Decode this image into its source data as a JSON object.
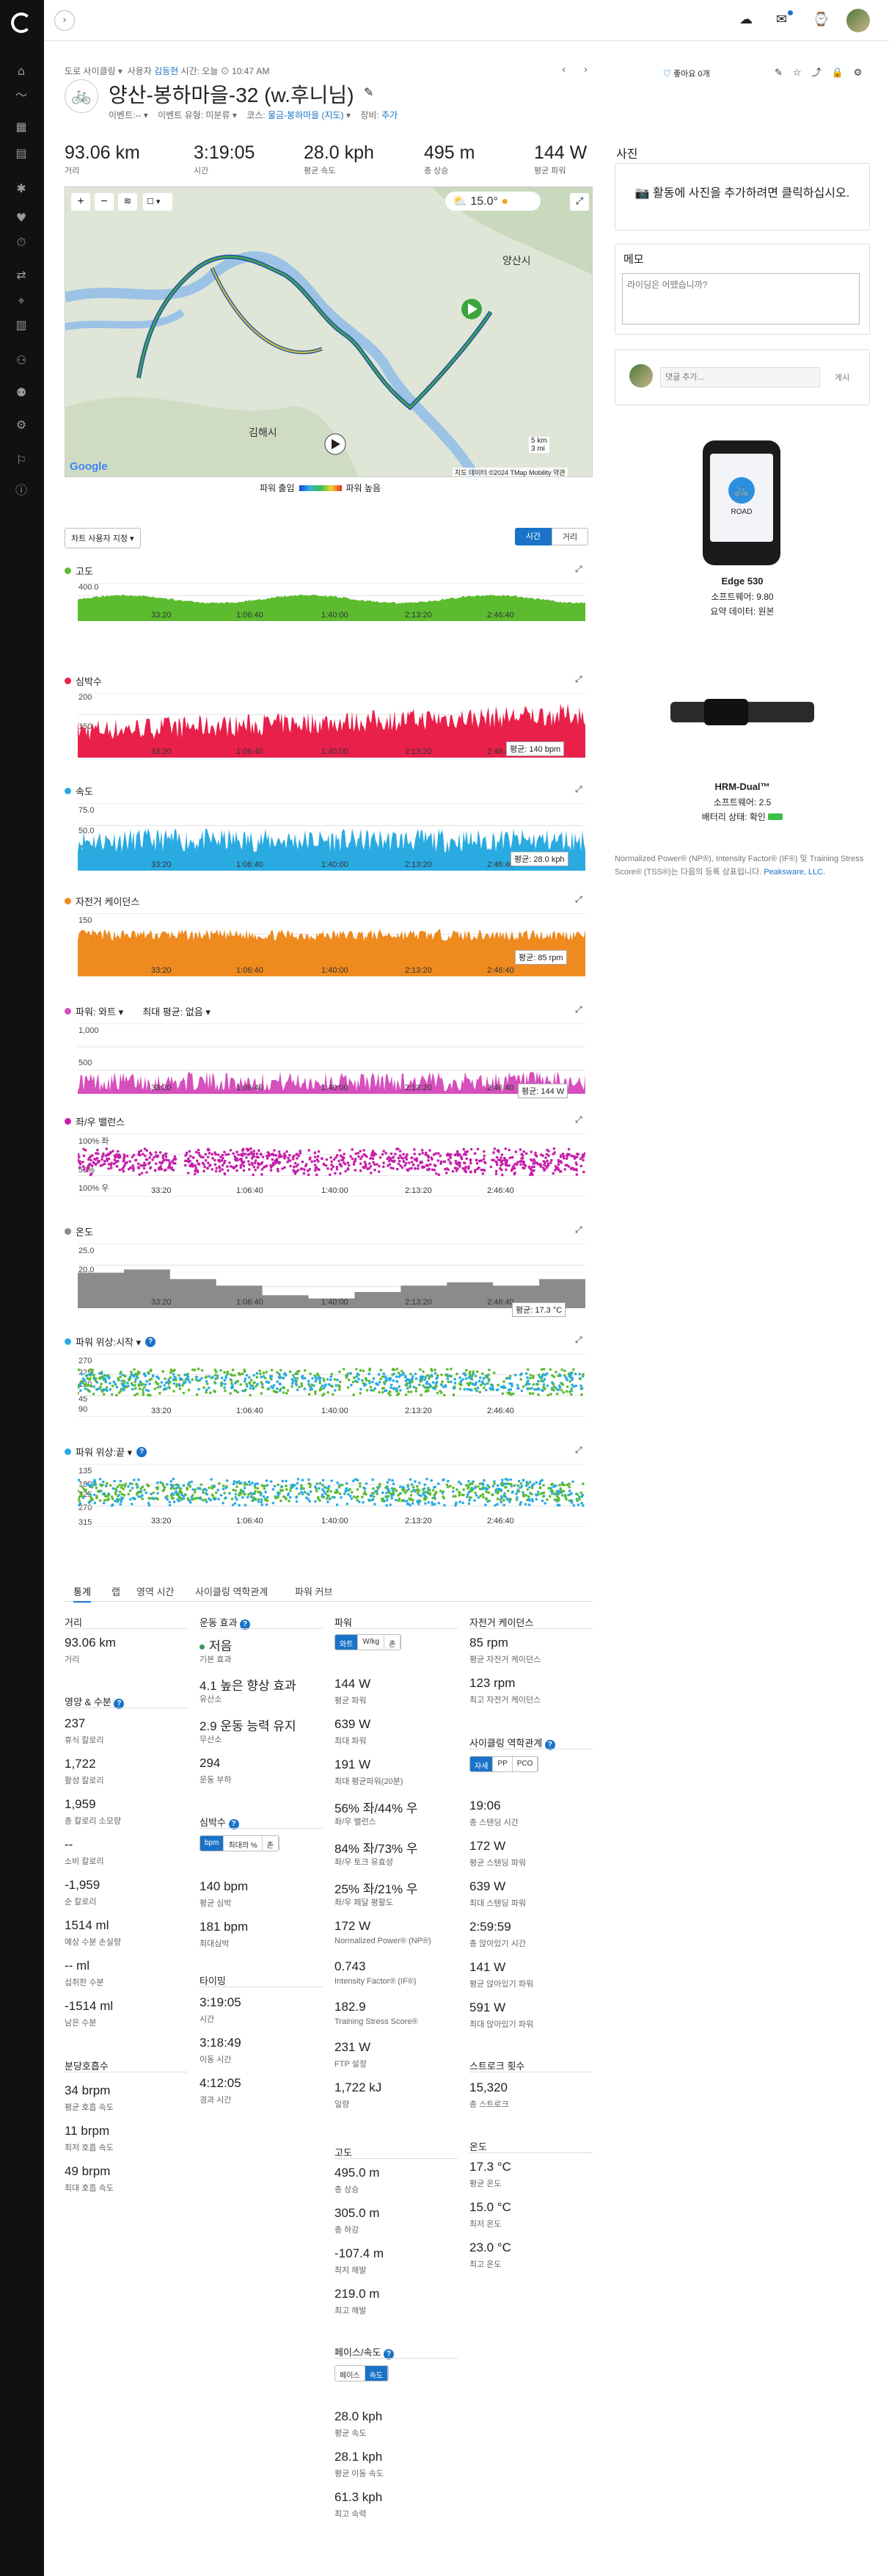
{
  "colors": {
    "accent": "#1a73c8",
    "elevation": "#5cbb2f",
    "heart": "#e8204a",
    "speed": "#29abe2",
    "cadence": "#ef8a1e",
    "power": "#d64fbd",
    "balance": "#c61fa9",
    "temp": "#8b8b8b",
    "powerphase_a": "#29abe2",
    "powerphase_b": "#5cbb2f"
  },
  "sidebar": {
    "icons": [
      "home-icon",
      "trend-icon",
      "calendar-icon",
      "report-icon",
      "activity-icon",
      "health-icon",
      "training-icon",
      "course-icon",
      "location-icon",
      "stats-icon",
      "connections-icon",
      "groups-icon",
      "gear-icon",
      "goals-icon",
      "insights-icon"
    ]
  },
  "header": {
    "breadcrumb": "도로 사이클링",
    "user_prefix": "사용자",
    "user": "김동현",
    "time_label": "시간: 오늘 ⊙ 10:47 AM",
    "title": "양산-봉하마을-32 (w.후니님)",
    "event": "이벤트:--",
    "event_type": "이벤트 유형: 미분류",
    "course_label": "코스:",
    "course": "물금-봉하마을 (지도)",
    "gear_label": "장비:",
    "gear": "추가",
    "likes": "좋아요 0개"
  },
  "stats": [
    {
      "value": "93.06 km",
      "label": "거리"
    },
    {
      "value": "3:19:05",
      "label": "시간"
    },
    {
      "value": "28.0 kph",
      "label": "평균 속도"
    },
    {
      "value": "495 m",
      "label": "총 상승"
    },
    {
      "value": "144 W",
      "label": "평균 파워"
    }
  ],
  "map": {
    "temp": "15.0°",
    "labels": [
      "양산시",
      "김해시"
    ],
    "scale": [
      "5 km",
      "3 mi"
    ],
    "attribution": "지도 데이터 ©2024 TMap Mobility   약관",
    "legend_low": "파워 출임",
    "legend_high": "파워 높음",
    "brand": "Google"
  },
  "chart_controls": {
    "custom": "차트 사용자 지정 ▾",
    "time": "시간",
    "distance": "거리"
  },
  "x_ticks": [
    "33:20",
    "1:06:40",
    "1:40:00",
    "2:13:20",
    "2:46:40"
  ],
  "charts": {
    "elevation": {
      "title": "고도",
      "y": [
        "400.0",
        "200.0",
        "0"
      ]
    },
    "heart": {
      "title": "심박수",
      "y": [
        "200",
        "150",
        "100"
      ],
      "avg": "평균: 140 bpm"
    },
    "speed": {
      "title": "속도",
      "y": [
        "75.0",
        "50.0",
        "25.0"
      ],
      "avg": "평균: 28.0 kph"
    },
    "cadence": {
      "title": "자전거 케이던스",
      "y": [
        "150",
        "100",
        "50"
      ],
      "avg": "평균: 85 rpm"
    },
    "power": {
      "title": "파워: 와트 ▾",
      "title2": "최대 평균: 없음 ▾",
      "y": [
        "1,000",
        "500"
      ],
      "avg": "평균: 144 W"
    },
    "balance": {
      "title": "좌/우 밸런스",
      "y": [
        "100% 좌",
        "50%",
        "100% 우"
      ]
    },
    "temp": {
      "title": "온도",
      "y": [
        "25.0",
        "20.0",
        "15.0"
      ],
      "avg": "평균: 17.3 °C"
    },
    "phase_start": {
      "title": "파워 위상:시작 ▾",
      "y": [
        "270",
        "225",
        "180",
        "45",
        "90"
      ]
    },
    "phase_end": {
      "title": "파워 위상:끝 ▾",
      "y": [
        "135",
        "180",
        "225",
        "270",
        "315"
      ]
    }
  },
  "tabs": [
    "통계",
    "랩",
    "영역 시간",
    "사이클링 역학관계",
    "파워 커브"
  ],
  "col1": {
    "distance": {
      "head": "거리",
      "value": "93.06 km",
      "label": "거리"
    },
    "nutrition": {
      "head": "영양 & 수분",
      "items": [
        {
          "v": "237",
          "l": "휴식 칼로리"
        },
        {
          "v": "1,722",
          "l": "활성 칼로리"
        },
        {
          "v": "1,959",
          "l": "총 칼로리 소모량"
        },
        {
          "v": "--",
          "l": "소비 칼로리"
        },
        {
          "v": "-1,959",
          "l": "순 칼로리"
        },
        {
          "v": "1514 ml",
          "l": "예상 수분 손실량"
        },
        {
          "v": "-- ml",
          "l": "섭취한 수분"
        },
        {
          "v": "-1514 ml",
          "l": "남은 수분"
        }
      ]
    },
    "breath": {
      "head": "분당호흡수",
      "items": [
        {
          "v": "34 brpm",
          "l": "평균 호흡 속도"
        },
        {
          "v": "11 brpm",
          "l": "최저 호흡 속도"
        },
        {
          "v": "49 brpm",
          "l": "최대 호흡 속도"
        }
      ]
    }
  },
  "col2": {
    "effect": {
      "head": "운동 효과",
      "aerobic_dot": "저음",
      "aerobic_lbl": "기본 효과",
      "items": [
        {
          "v": "4.1 높은 향상 효과",
          "l": "유산소"
        },
        {
          "v": "2.9 운동 능력 유지",
          "l": "무산소"
        },
        {
          "v": "294",
          "l": "운동 부하"
        }
      ]
    },
    "hr": {
      "head": "심박수",
      "seg": [
        "bpm",
        "최대의 %",
        "존"
      ],
      "items": [
        {
          "v": "140 bpm",
          "l": "평균 심박"
        },
        {
          "v": "181 bpm",
          "l": "최대심박"
        }
      ]
    },
    "timing": {
      "head": "타이밍",
      "items": [
        {
          "v": "3:19:05",
          "l": "시간"
        },
        {
          "v": "3:18:49",
          "l": "이동 시간"
        },
        {
          "v": "4:12:05",
          "l": "경과 시간"
        }
      ]
    }
  },
  "col3": {
    "power": {
      "head": "파워",
      "seg": [
        "와트",
        "W/kg",
        "존"
      ],
      "items": [
        {
          "v": "144 W",
          "l": "평균 파워"
        },
        {
          "v": "639 W",
          "l": "최대 파워"
        },
        {
          "v": "191 W",
          "l": "최대 평균파워(20분)"
        },
        {
          "v": "56% 좌/44% 우",
          "l": "좌/우 밸런스"
        },
        {
          "v": "84% 좌/73% 우",
          "l": "좌/우 토크 유효성"
        },
        {
          "v": "25% 좌/21% 우",
          "l": "좌/우 페달 평활도"
        },
        {
          "v": "172 W",
          "l": "Normalized Power® (NP®)"
        },
        {
          "v": "0.743",
          "l": "Intensity Factor® (IF®)"
        },
        {
          "v": "182.9",
          "l": "Training Stress Score®"
        },
        {
          "v": "231 W",
          "l": "FTP 설정"
        },
        {
          "v": "1,722 kJ",
          "l": "일량"
        }
      ]
    },
    "elev": {
      "head": "고도",
      "items": [
        {
          "v": "495.0 m",
          "l": "총 상승"
        },
        {
          "v": "305.0 m",
          "l": "총 하강"
        },
        {
          "v": "-107.4 m",
          "l": "최저 해발"
        },
        {
          "v": "219.0 m",
          "l": "최고 해발"
        }
      ]
    },
    "pace": {
      "head": "페이스/속도",
      "seg": [
        "페이스",
        "속도"
      ],
      "items": [
        {
          "v": "28.0 kph",
          "l": "평균 속도"
        },
        {
          "v": "28.1 kph",
          "l": "평균 이동 속도"
        },
        {
          "v": "61.3 kph",
          "l": "최고 속력"
        }
      ]
    }
  },
  "col4": {
    "cadence": {
      "head": "자전거 케이던스",
      "items": [
        {
          "v": "85 rpm",
          "l": "평균 자전거 케이던스"
        },
        {
          "v": "123 rpm",
          "l": "최고 자전거 케이던스"
        }
      ]
    },
    "dyn": {
      "head": "사이클링 역학관계",
      "seg": [
        "자세",
        "PP",
        "PCO"
      ],
      "items": [
        {
          "v": "19:06",
          "l": "총 스탠딩 시간"
        },
        {
          "v": "172 W",
          "l": "평균 스탠딩 파워"
        },
        {
          "v": "639 W",
          "l": "최대 스탠딩 파워"
        },
        {
          "v": "2:59:59",
          "l": "총 앉아있기 시간"
        },
        {
          "v": "141 W",
          "l": "평균 앉아있기 파워"
        },
        {
          "v": "591 W",
          "l": "최대 앉아있기 파워"
        }
      ]
    },
    "stroke": {
      "head": "스트로크 횟수",
      "items": [
        {
          "v": "15,320",
          "l": "총 스트로크"
        }
      ]
    },
    "temp": {
      "head": "온도",
      "items": [
        {
          "v": "17.3 °C",
          "l": "평균 온도"
        },
        {
          "v": "15.0 °C",
          "l": "최저 온도"
        },
        {
          "v": "23.0 °C",
          "l": "최고 온도"
        }
      ]
    }
  },
  "right": {
    "photos_head": "사진",
    "photos_text": "활동에 사진을 추가하려면 클릭하십시오.",
    "notes_head": "메모",
    "notes_placeholder": "라이딩은 어땠습니까?",
    "comment_placeholder": "댓글 추가...",
    "comment_post": "게시",
    "device1": {
      "name": "Edge 530",
      "sw": "소프트웨어: 9.80",
      "src": "요약 데이터: 원본",
      "screen": "ROAD"
    },
    "device2": {
      "name": "HRM-Dual™",
      "sw": "소프트웨어: 2.5",
      "battery": "배터리 상태: 확인"
    },
    "note": "Normalized Power® (NP®), Intensity Factor® (IF®) 및 Training Stress Score® (TSS®)는 다음의 등록 상표입니다.",
    "note_link": "Peaksware, LLC."
  },
  "chart_data": [
    {
      "type": "area",
      "title": "고도",
      "ylim": [
        0,
        400
      ],
      "x": [
        "0:00",
        "33:20",
        "1:06:40",
        "1:40:00",
        "2:13:20",
        "2:46:40",
        "3:19:05"
      ],
      "values": [
        30,
        15,
        40,
        5,
        60,
        80,
        20
      ]
    },
    {
      "type": "area",
      "title": "심박수",
      "ylim": [
        100,
        200
      ],
      "values": [
        115,
        125,
        135,
        140,
        150,
        170,
        140
      ]
    },
    {
      "type": "area",
      "title": "속도",
      "ylim": [
        0,
        75
      ],
      "values": [
        25,
        22,
        28,
        30,
        27,
        35,
        30
      ]
    },
    {
      "type": "area",
      "title": "자전거 케이던스",
      "ylim": [
        50,
        150
      ],
      "values": [
        85,
        88,
        86,
        84,
        87,
        82,
        85
      ]
    },
    {
      "type": "area",
      "title": "파워: 와트",
      "ylim": [
        0,
        1000
      ],
      "values": [
        150,
        140,
        145,
        150,
        160,
        170,
        140
      ]
    },
    {
      "type": "scatter",
      "title": "좌/우 밸런스"
    },
    {
      "type": "area",
      "title": "온도",
      "ylim": [
        15,
        25
      ],
      "values": [
        22,
        20,
        17,
        16,
        17.5,
        18,
        18
      ]
    },
    {
      "type": "scatter",
      "title": "파워 위상:시작"
    },
    {
      "type": "scatter",
      "title": "파워 위상:끝"
    }
  ]
}
